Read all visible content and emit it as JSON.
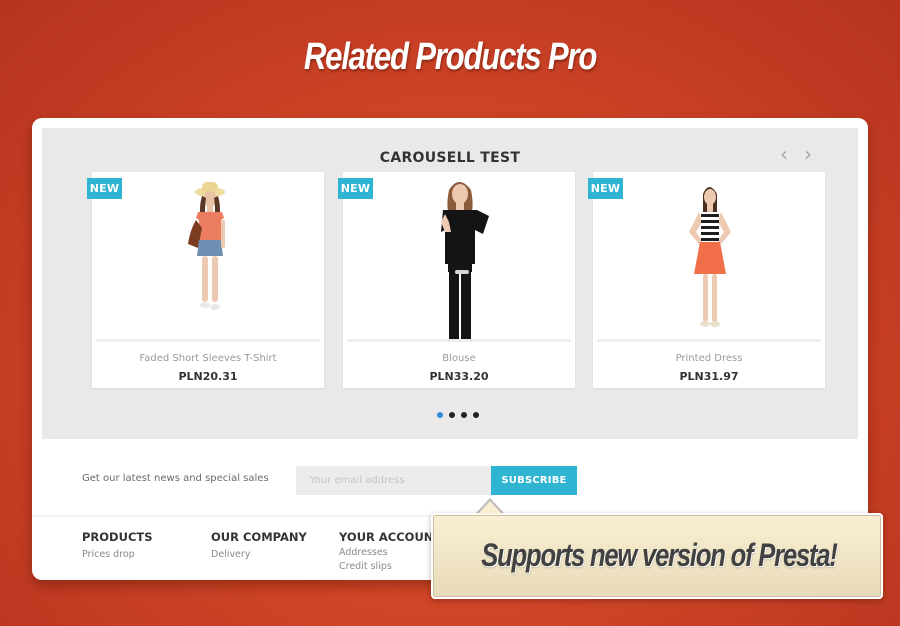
{
  "hero": {
    "title": "Related Products Pro"
  },
  "carousel": {
    "title": "CAROUSELL TEST",
    "prev_icon": "‹",
    "next_icon": "›",
    "products": [
      {
        "badge": "NEW",
        "name": "Faded Short Sleeves T-Shirt",
        "price": "PLN20.31"
      },
      {
        "badge": "NEW",
        "name": "Blouse",
        "price": "PLN33.20"
      },
      {
        "badge": "NEW",
        "name": "Printed Dress",
        "price": "PLN31.97"
      }
    ],
    "pagination": {
      "total": 4,
      "active": 1
    }
  },
  "newsletter": {
    "text": "Get our latest news and special sales",
    "placeholder": "Your email address",
    "value": "",
    "button": "SUBSCRIBE"
  },
  "footer": {
    "columns": [
      {
        "heading": "PRODUCTS",
        "links": [
          "Prices drop"
        ]
      },
      {
        "heading": "OUR COMPANY",
        "links": [
          "Delivery"
        ]
      },
      {
        "heading": "YOUR ACCOUNT",
        "links": [
          "Addresses",
          "Credit slips"
        ]
      }
    ]
  },
  "callout": {
    "text": "Supports new version of Presta!"
  },
  "colors": {
    "accent": "#2fb5d2",
    "background": "#cf4527",
    "active_dot": "#2f8ad8",
    "callout_bg": "#fbefd3"
  }
}
